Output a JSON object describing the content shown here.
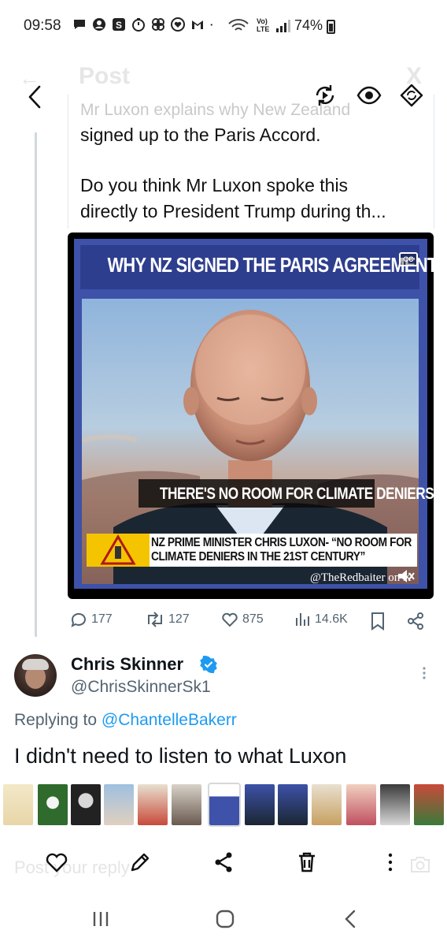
{
  "status_bar": {
    "time": "09:58",
    "battery_text": "74%",
    "icons": [
      "message-icon",
      "account-icon",
      "s-app-icon",
      "timer-icon",
      "pinwheel-icon",
      "heart-app-icon",
      "gmail-icon",
      "dot-icon",
      "wifi-icon",
      "volte-icon",
      "signal-icon",
      "battery-icon"
    ],
    "volte_label": "Vo) LTE"
  },
  "header": {
    "title": "Post",
    "icons": [
      "back-arrow-icon",
      "sync-icon",
      "eye-icon",
      "refresh-icon"
    ]
  },
  "quoted_post": {
    "partial_line": "Mr Luxon explains why New Zealand",
    "line1": "signed up to the Paris Accord.",
    "line2": "Do you think Mr Luxon spoke this",
    "line3": "directly to President Trump during th..."
  },
  "video": {
    "title": "WHY NZ SIGNED THE PARIS AGREEMENT",
    "cc_label": "CC",
    "caption": "THERE'S NO ROOM FOR CLIMATE DENIERS",
    "lower_third_line1": "NZ PRIME MINISTER CHRIS LUXON- “NO ROOM FOR",
    "lower_third_line2": "CLIMATE DENIERS IN THE 21ST CENTURY”",
    "watermark": "@TheRedbaiter on X"
  },
  "actions": {
    "replies": "177",
    "reposts": "127",
    "likes": "875",
    "views": "14.6K"
  },
  "reply": {
    "name": "Chris Skinner",
    "handle": "@ChrisSkinnerSk1",
    "replying_prefix": "Replying to",
    "replying_to": "@ChantelleBakerr",
    "text": "I didn't need to listen to what Luxon"
  },
  "compose": {
    "placeholder": "Post your reply"
  },
  "colors": {
    "accent": "#1d9bf0",
    "muted": "#536471",
    "video_blue": "#3d52a8",
    "lower_third_yellow": "#f4c400"
  }
}
